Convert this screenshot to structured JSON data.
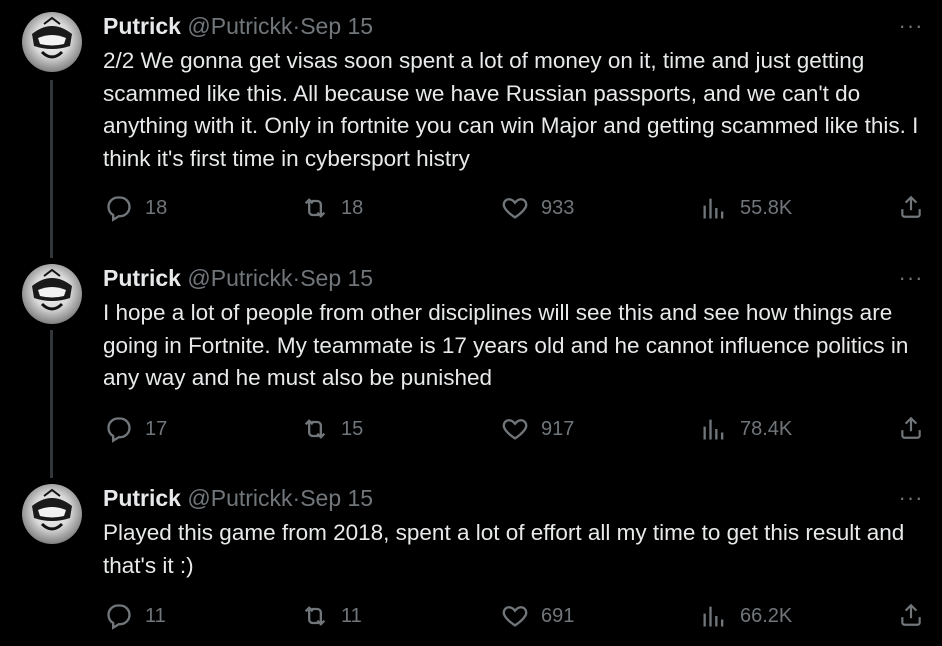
{
  "tweets": [
    {
      "name": "Putrick",
      "handle": "@Putrickk",
      "separator": "·",
      "date": "Sep 15",
      "more": "···",
      "text": "2/2 We gonna get visas soon spent a lot of money on it, time and just getting scammed like this. All because we have Russian passports, and we can't do anything with it. Only in fortnite you can win Major and getting scammed like this. I think it's first time in cybersport histry",
      "replies": "18",
      "retweets": "18",
      "likes": "933",
      "views": "55.8K"
    },
    {
      "name": "Putrick",
      "handle": "@Putrickk",
      "separator": "·",
      "date": "Sep 15",
      "more": "···",
      "text": "I hope a lot of people from other disciplines will see this and see how things are going in Fortnite. My teammate is 17 years old and he cannot influence politics in any way and he must also be punished",
      "replies": "17",
      "retweets": "15",
      "likes": "917",
      "views": "78.4K"
    },
    {
      "name": "Putrick",
      "handle": "@Putrickk",
      "separator": "·",
      "date": "Sep 15",
      "more": "···",
      "text": "Played this game from 2018, spent a lot of effort all my time to get this result and that's it :)",
      "replies": "11",
      "retweets": "11",
      "likes": "691",
      "views": "66.2K"
    }
  ],
  "icons": {
    "reply": "reply-icon",
    "retweet": "retweet-icon",
    "like": "heart-icon",
    "views": "views-icon",
    "share": "share-icon"
  },
  "colors": {
    "background": "#000000",
    "text": "#e7e9ea",
    "muted": "#71767b",
    "thread_line": "#333639"
  }
}
